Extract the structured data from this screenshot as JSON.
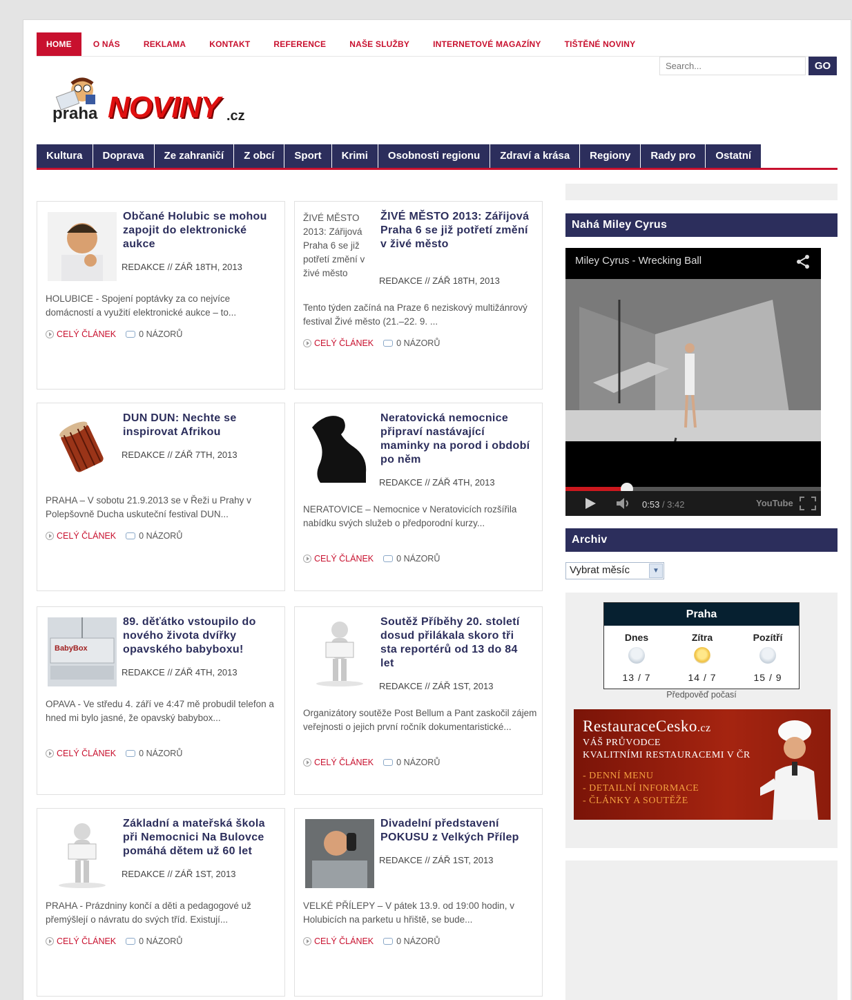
{
  "top_nav": [
    "HOME",
    "O NÁS",
    "REKLAMA",
    "KONTAKT",
    "REFERENCE",
    "NAŠE SLUŽBY",
    "INTERNETOVÉ MAGAZÍNY",
    "TIŠTĚNÉ NOVINY"
  ],
  "search": {
    "placeholder": "Search...",
    "button": "GO"
  },
  "logo": {
    "city": "praha",
    "name": "NOVINY",
    "tld": ".cz"
  },
  "categories": [
    "Kultura",
    "Doprava",
    "Ze zahraničí",
    "Z obcí",
    "Sport",
    "Krimi",
    "Osobnosti regionu",
    "Zdraví a krása",
    "Regiony",
    "Rady pro",
    "Ostatní"
  ],
  "posts": [
    {
      "title": "Občané Holubic se mohou zapojit do elektronické aukce",
      "meta": "REDAKCE // ZÁŘ 18TH, 2013",
      "excerpt": "HOLUBICE - Spojení poptávky za co nejvíce domácností a využití elektronické aukce – to...",
      "more": "CELÝ ČLÁNEK",
      "comments": "0 NÁZORŮ"
    },
    {
      "title": "ŽIVÉ MĚSTO 2013: Zářijová Praha 6 se již potřetí změní v živé město",
      "thumb_alt": "ŽIVÉ MĚSTO 2013: Zářijová Praha 6 se již potřetí změní v živé město",
      "meta": "REDAKCE // ZÁŘ 18TH, 2013",
      "excerpt": "Tento týden začíná na Praze 6 neziskový multižánrový festival Živé město (21.–22. 9. ...",
      "more": "CELÝ ČLÁNEK",
      "comments": "0 NÁZORŮ"
    },
    {
      "title": "DUN DUN: Nechte se inspirovat Afrikou",
      "meta": "REDAKCE // ZÁŘ 7TH, 2013",
      "excerpt": "PRAHA – V sobotu 21.9.2013 se v Řeži u Prahy v Polepšovně Ducha uskuteční festival DUN...",
      "more": "CELÝ ČLÁNEK",
      "comments": "0 NÁZORŮ"
    },
    {
      "title": "Neratovická nemocnice připraví nastávající maminky na porod i období po něm",
      "meta": "REDAKCE // ZÁŘ 4TH, 2013",
      "excerpt": "NERATOVICE – Nemocnice v Neratovicích rozšířila nabídku svých služeb o předporodní kurzy...",
      "more": "CELÝ ČLÁNEK",
      "comments": "0 NÁZORŮ"
    },
    {
      "title": "89. děťátko vstoupilo do nového života dvířky opavského babyboxu!",
      "thumb_label": "BabyBox",
      "meta": "REDAKCE // ZÁŘ 4TH, 2013",
      "excerpt": "OPAVA - Ve středu 4. září ve 4:47 mě probudil telefon a hned mi bylo jasné, že opavský babybox...",
      "more": "CELÝ ČLÁNEK",
      "comments": "0 NÁZORŮ"
    },
    {
      "title": "Soutěž Příběhy 20. století dosud přilákala skoro tři sta reportérů od 13 do 84 let",
      "meta": "REDAKCE // ZÁŘ 1ST, 2013",
      "excerpt": "Organizátory soutěže Post Bellum a Pant zaskočil zájem veřejnosti o jejich první ročník dokumentaristické...",
      "more": "CELÝ ČLÁNEK",
      "comments": "0 NÁZORŮ"
    },
    {
      "title": "Základní a mateřská škola při Nemocnici Na Bulovce pomáhá dětem už 60 let",
      "meta": "REDAKCE // ZÁŘ 1ST, 2013",
      "excerpt": "PRAHA - Prázdniny končí a děti a pedagogové už přemýšlejí o návratu do svých tříd. Existují...",
      "more": "CELÝ ČLÁNEK",
      "comments": "0 NÁZORŮ"
    },
    {
      "title": "Divadelní představení POKUSU z Velkých Přílep",
      "meta": "REDAKCE // ZÁŘ 1ST, 2013",
      "excerpt": "VELKÉ PŘÍLEPY – V pátek 13.9. od 19:00 hodin, v Holubicích na parketu u hřiště, se bude...",
      "more": "CELÝ ČLÁNEK",
      "comments": "0 NÁZORŮ"
    }
  ],
  "sidebar": {
    "video_widget_title": "Nahá Miley Cyrus",
    "video": {
      "title": "Miley Cyrus - Wrecking Ball",
      "current": "0:53",
      "duration": "/ 3:42",
      "logo": "YouTube",
      "progress": 0.24
    },
    "archive_title": "Archiv",
    "archive_select": "Vybrat měsíc",
    "weather": {
      "city": "Praha",
      "days": [
        {
          "day": "Dnes",
          "temp": "13 / 7"
        },
        {
          "day": "Zítra",
          "temp": "14 / 7"
        },
        {
          "day": "Pozítří",
          "temp": "15 / 9"
        }
      ],
      "link": "Předpověď počasí"
    },
    "ad": {
      "brand": "RestauraceCesko",
      "tld": ".cz",
      "tag1": "VÁŠ PRŮVODCE",
      "tag2": "KVALITNÍMI RESTAURACEMI V ČR",
      "items": [
        "- DENNÍ MENU",
        "- DETAILNÍ INFORMACE",
        "- ČLÁNKY A SOUTĚŽE"
      ]
    }
  },
  "colors": {
    "brand_red": "#c8102e",
    "navy": "#2c2e5c"
  }
}
